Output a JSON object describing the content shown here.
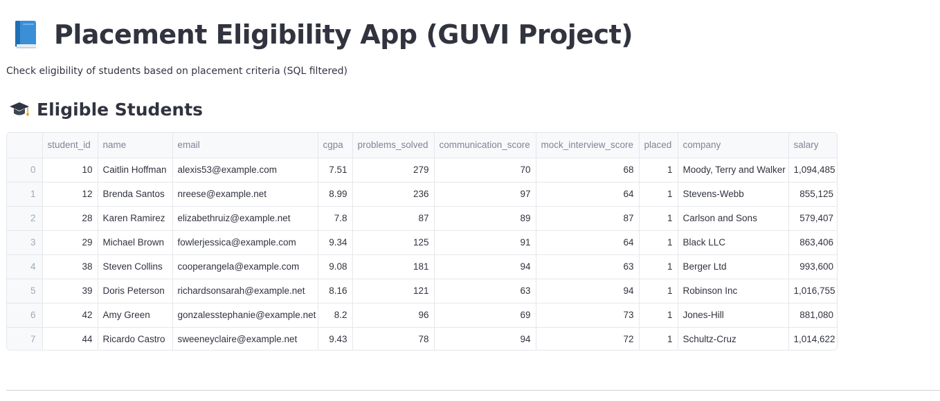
{
  "header": {
    "icon": "blue-book-icon",
    "title": "Placement Eligibility App (GUVI Project)",
    "subtitle": "Check eligibility of students based on placement criteria (SQL filtered)"
  },
  "section": {
    "icon": "graduation-cap-icon",
    "title": "Eligible Students"
  },
  "table": {
    "columns": [
      "",
      "student_id",
      "name",
      "email",
      "cgpa",
      "problems_solved",
      "communication_score",
      "mock_interview_score",
      "placed",
      "company",
      "salary"
    ],
    "rows": [
      [
        "0",
        "10",
        "Caitlin Hoffman",
        "alexis53@example.com",
        "7.51",
        "279",
        "70",
        "68",
        "1",
        "Moody, Terry and Walker",
        "1,094,485"
      ],
      [
        "1",
        "12",
        "Brenda Santos",
        "nreese@example.net",
        "8.99",
        "236",
        "97",
        "64",
        "1",
        "Stevens-Webb",
        "855,125"
      ],
      [
        "2",
        "28",
        "Karen Ramirez",
        "elizabethruiz@example.net",
        "7.8",
        "87",
        "89",
        "87",
        "1",
        "Carlson and Sons",
        "579,407"
      ],
      [
        "3",
        "29",
        "Michael Brown",
        "fowlerjessica@example.com",
        "9.34",
        "125",
        "91",
        "64",
        "1",
        "Black LLC",
        "863,406"
      ],
      [
        "4",
        "38",
        "Steven Collins",
        "cooperangela@example.com",
        "9.08",
        "181",
        "94",
        "63",
        "1",
        "Berger Ltd",
        "993,600"
      ],
      [
        "5",
        "39",
        "Doris Peterson",
        "richardsonsarah@example.net",
        "8.16",
        "121",
        "63",
        "94",
        "1",
        "Robinson Inc",
        "1,016,755"
      ],
      [
        "6",
        "42",
        "Amy Green",
        "gonzalesstephanie@example.net",
        "8.2",
        "96",
        "69",
        "73",
        "1",
        "Jones-Hill",
        "881,080"
      ],
      [
        "7",
        "44",
        "Ricardo Castro",
        "sweeneyclaire@example.net",
        "9.43",
        "78",
        "94",
        "72",
        "1",
        "Schultz-Cruz",
        "1,014,622"
      ]
    ]
  },
  "colors": {
    "text": "#31333f",
    "header_text": "#808495",
    "index_text": "#a3a8b8",
    "grid_border": "#e6e7eb",
    "header_bg": "#f8f9fb"
  }
}
